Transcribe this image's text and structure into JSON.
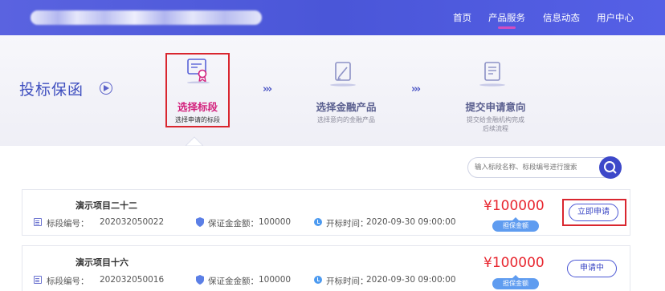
{
  "header": {
    "nav": [
      "首页",
      "产品服务",
      "信息动态",
      "用户中心"
    ]
  },
  "band": {
    "title": "投标保函",
    "steps": [
      {
        "label": "选择标段",
        "sub": "选择申请的标段",
        "active": true
      },
      {
        "label": "选择金融产品",
        "sub": "选择意向的金融产品",
        "active": false
      },
      {
        "label": "提交申请意向",
        "sub": "提交给金融机构完成\n后续流程",
        "active": false
      }
    ],
    "arrow": "›››"
  },
  "search": {
    "placeholder": "输入标段名称、标段编号进行搜索"
  },
  "projects": [
    {
      "title": "演示项目二十二",
      "code_label": "标段编号：",
      "code": "202032050022",
      "deposit_label": "保证金金额：",
      "deposit": "100000",
      "open_label": "开标时间：",
      "open_time": "2020-09-30 09:00:00",
      "price": "¥100000",
      "price_tag": "担保金额",
      "button": "立即申请"
    },
    {
      "title": "演示项目十六",
      "code_label": "标段编号：",
      "code": "202032050016",
      "deposit_label": "保证金金额：",
      "deposit": "100000",
      "open_label": "开标时间：",
      "open_time": "2020-09-30 09:00:00",
      "price": "¥100000",
      "price_tag": "担保金额",
      "button": "申请中"
    }
  ],
  "colors": {
    "header": "#4a56d8",
    "accent": "#3d48c9",
    "step_active": "#d3227d",
    "price": "#e8262f",
    "highlight_box": "#d9262f"
  }
}
